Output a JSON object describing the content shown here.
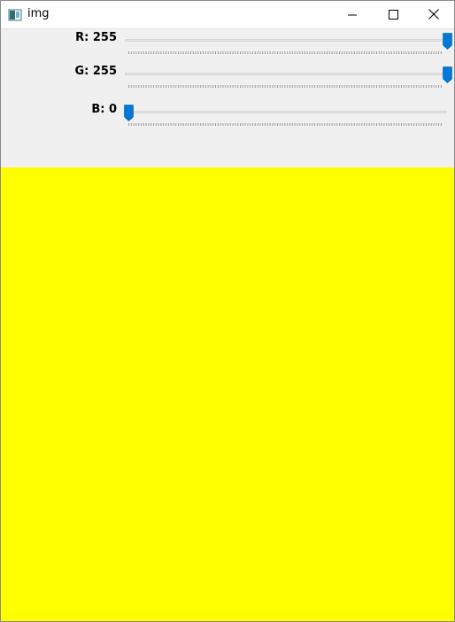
{
  "window": {
    "title": "img",
    "icon": "window-app-icon",
    "controls": [
      "minimize-icon",
      "maximize-icon",
      "close-icon"
    ]
  },
  "trackbars": [
    {
      "channel": "R",
      "label": "R: 255",
      "value": 255,
      "min": 0,
      "max": 255
    },
    {
      "channel": "G",
      "label": "G: 255",
      "value": 255,
      "min": 0,
      "max": 255
    },
    {
      "channel": "B",
      "label": "B: 0",
      "value": 0,
      "min": 0,
      "max": 255
    }
  ],
  "colors": {
    "image_fill": "#ffff00",
    "thumb": "#0078d7",
    "panel": "#f0f0f0"
  }
}
